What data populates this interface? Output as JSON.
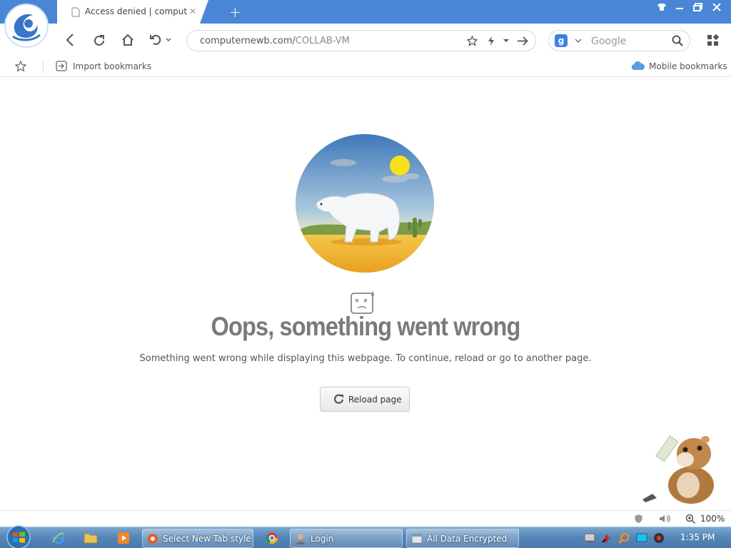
{
  "browser": {
    "tab_title": "Access denied | computernewb",
    "new_tab_symbol": "+",
    "url_host": "computernewb.com/",
    "url_path": "COLLAB-VM",
    "search_engine_badge": "g",
    "search_placeholder": "Google"
  },
  "bookmarks": {
    "import_label": "Import bookmarks",
    "mobile_label": "Mobile bookmarks"
  },
  "error_page": {
    "title": "Oops, something went wrong",
    "description": "Something went wrong while displaying this webpage. To continue, reload or go to another page.",
    "reload_label": "Reload page"
  },
  "status": {
    "zoom": "100%"
  },
  "taskbar": {
    "items": [
      {
        "label": "Select New Tab style ..."
      },
      {
        "label": "Login"
      },
      {
        "label": "All Data Encrypted"
      }
    ],
    "clock": "1:35 PM"
  },
  "colors": {
    "titlebar": "#4a86d6",
    "taskbar": "#5687b8",
    "accent": "#3b82e6",
    "error_title": "#7a7a7a"
  },
  "icons": [
    "browser-logo-icon",
    "page-icon",
    "close-icon",
    "shirt-icon",
    "minimize-icon",
    "restore-icon",
    "close-window-icon",
    "back-icon",
    "refresh-icon",
    "home-icon",
    "undo-icon",
    "star-icon",
    "lightning-icon",
    "dropdown-icon",
    "go-arrow-icon",
    "search-icon",
    "apps-grid-icon",
    "import-icon",
    "cloud-icon",
    "sad-face-icon",
    "reload-icon",
    "shield-icon",
    "speaker-icon",
    "zoom-icon",
    "start-orb-icon",
    "ie-icon",
    "folder-icon",
    "media-player-icon",
    "chrome-icon"
  ]
}
